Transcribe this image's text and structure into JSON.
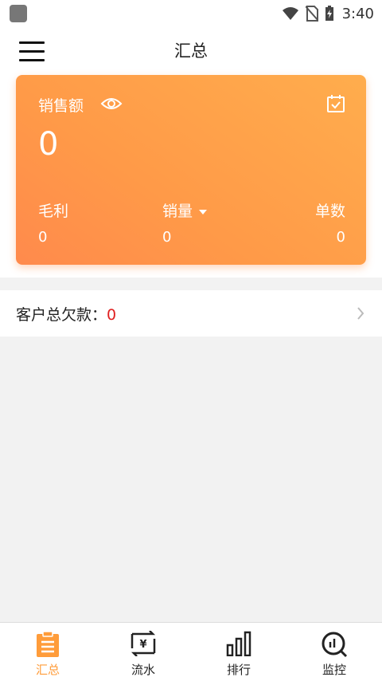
{
  "status_bar": {
    "time": "3:40"
  },
  "header": {
    "title": "汇总"
  },
  "sales_card": {
    "label": "销售额",
    "value": "0",
    "metrics": [
      {
        "label": "毛利",
        "value": "0"
      },
      {
        "label": "销量",
        "value": "0"
      },
      {
        "label": "单数",
        "value": "0"
      }
    ]
  },
  "customer_debt": {
    "label": "客户总欠款：",
    "value": "0"
  },
  "bottom_nav": [
    {
      "label": "汇总",
      "icon": "clipboard-icon",
      "active": true
    },
    {
      "label": "流水",
      "icon": "yuan-exchange-icon",
      "active": false
    },
    {
      "label": "排行",
      "icon": "bar-chart-icon",
      "active": false
    },
    {
      "label": "监控",
      "icon": "monitor-search-icon",
      "active": false
    }
  ],
  "colors": {
    "accent": "#ff9c3a",
    "card_start": "#ff8a4c",
    "card_end": "#ffad4d",
    "debt_value": "#e02020"
  }
}
